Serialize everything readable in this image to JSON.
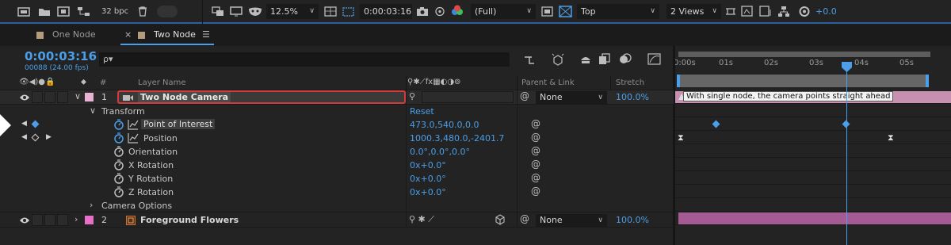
{
  "viewer_bar": {
    "bpc": "32 bpc",
    "zoom": "12.5%",
    "timecode": "0:00:03:16",
    "resolution": "(Full)",
    "view": "Top",
    "views_layout": "2 Views",
    "exposure": "+0.0"
  },
  "tabs": [
    {
      "label": "One Node",
      "close": ""
    },
    {
      "label": "Two Node",
      "close": "×",
      "menu": "☰"
    }
  ],
  "current_time": "0:00:03:16",
  "frame_info": "00088 (24.00 fps)",
  "search": {
    "placeholder": "",
    "icon_label": "ρ▾"
  },
  "columns": {
    "num": "#",
    "layer_name": "Layer Name",
    "parent_link": "Parent & Link",
    "stretch": "Stretch"
  },
  "ruler": [
    "0:00s",
    "01s",
    "02s",
    "03s",
    "04s",
    "05s"
  ],
  "layers": [
    {
      "index": "1",
      "name": "Two Node Camera",
      "parent": "None",
      "stretch": "100.0%",
      "label_color": "#e8b4d2"
    },
    {
      "index": "2",
      "name": "Foreground Flowers",
      "parent": "None",
      "stretch": "100.0%",
      "label_color": "#e86fc7"
    }
  ],
  "transform": {
    "label": "Transform",
    "reset": "Reset",
    "properties": [
      {
        "name": "Point of Interest",
        "value": "473.0,540.0,0.0"
      },
      {
        "name": "Position",
        "value": "1000.3,480.0,-2401.7"
      },
      {
        "name": "Orientation",
        "value": "0.0°,0.0°,0.0°"
      },
      {
        "name": "X Rotation",
        "value": "0x+0.0°"
      },
      {
        "name": "Y Rotation",
        "value": "0x+0.0°"
      },
      {
        "name": "Z Rotation",
        "value": "0x+0.0°"
      }
    ]
  },
  "camera_options": "Camera Options",
  "comment_marker": "With single node, the camera points straight ahead",
  "colors": {
    "accent": "#4c9ee8",
    "camera_bar": "#c790b0",
    "flowers_bar": "#a45a93",
    "highlight": "#d43a3a"
  }
}
